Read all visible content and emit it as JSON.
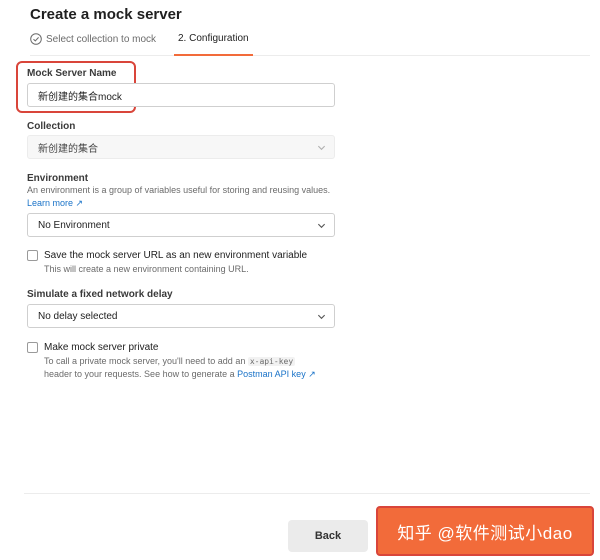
{
  "dialog": {
    "title": "Create a mock server"
  },
  "steps": [
    {
      "label": "Select collection to mock",
      "icon": "check-circle-icon"
    },
    {
      "label": "2. Configuration"
    }
  ],
  "form": {
    "mock_name": {
      "label": "Mock Server Name",
      "value": "新创建的集合mock"
    },
    "collection": {
      "label": "Collection",
      "value": "新创建的集合"
    },
    "environment": {
      "label": "Environment",
      "description": "An environment is a group of variables useful for storing and reusing values.",
      "learn_more": "Learn more ↗",
      "value": "No Environment"
    },
    "save_url": {
      "label": "Save the mock server URL as an new environment variable",
      "description": "This will create a new environment containing URL.",
      "checked": false
    },
    "delay": {
      "label": "Simulate a fixed network delay",
      "value": "No delay selected"
    },
    "private": {
      "label": "Make mock server private",
      "desc_part1": "To call a private mock server, you'll need to add an",
      "code": "x-api-key",
      "desc_part2": "header to your requests. See how to generate a",
      "link": "Postman API key ↗",
      "checked": false
    }
  },
  "footer": {
    "back_label": "Back",
    "watermark": "知乎 @软件测试小dao"
  },
  "colors": {
    "accent": "#f26b3a",
    "highlight": "#d9453a",
    "link": "#1a73c8"
  }
}
